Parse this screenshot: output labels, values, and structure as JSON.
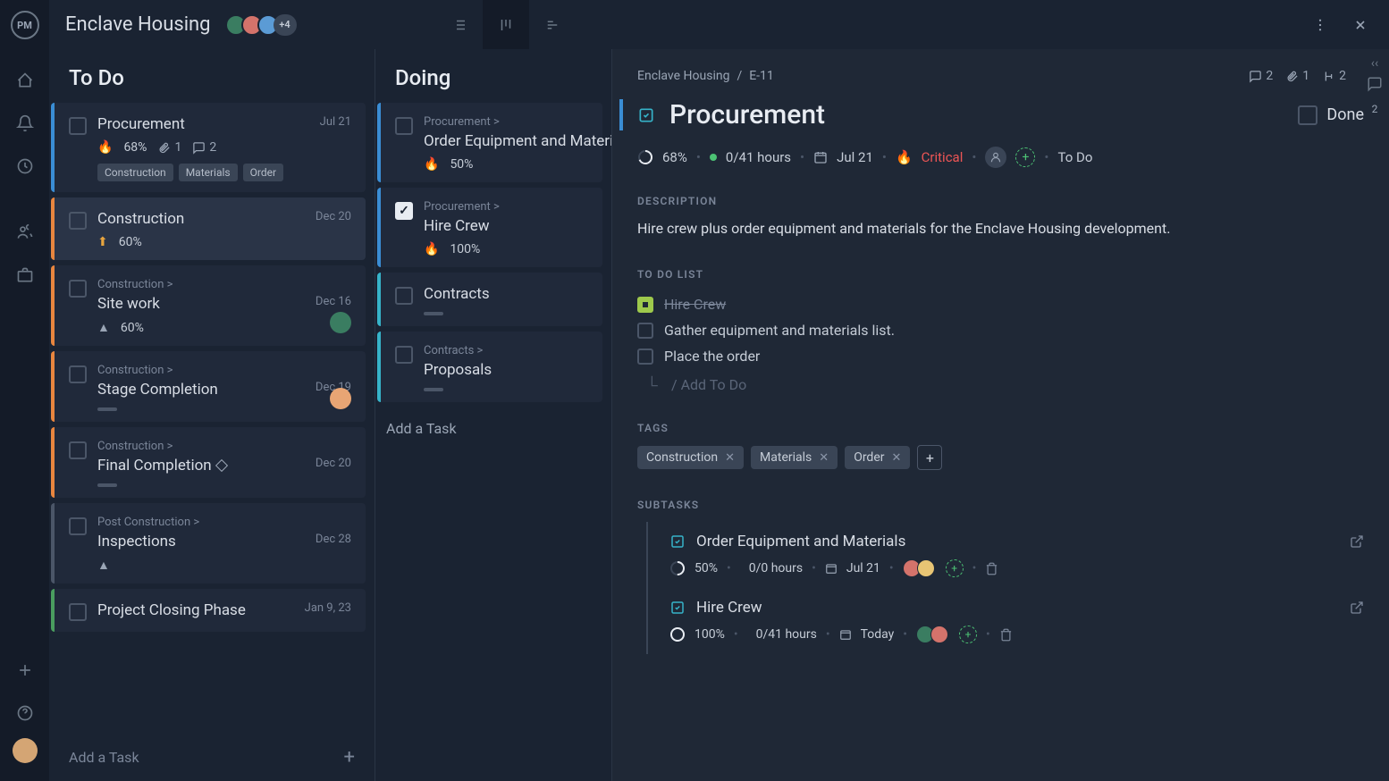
{
  "header": {
    "title": "Enclave Housing",
    "avatar_overflow": "+4"
  },
  "columns": {
    "todo": {
      "title": "To Do",
      "add_label": "Add a Task",
      "cards": [
        {
          "title": "Procurement",
          "date": "Jul 21",
          "pct": "68%",
          "attach": "1",
          "comments": "2",
          "tags": [
            "Construction",
            "Materials",
            "Order"
          ]
        },
        {
          "title": "Construction",
          "date": "Dec 20",
          "pct": "60%"
        },
        {
          "title": "Site work",
          "parent": "Construction >",
          "date": "Dec 16",
          "pct": "60%"
        },
        {
          "title": "Stage Completion",
          "parent": "Construction >",
          "date": "Dec 19"
        },
        {
          "title": "Final Completion",
          "parent": "Construction >",
          "date": "Dec 20"
        },
        {
          "title": "Inspections",
          "parent": "Post Construction >",
          "date": "Dec 28"
        },
        {
          "title": "Project Closing Phase",
          "date": "Jan 9, 23"
        }
      ]
    },
    "doing": {
      "title": "Doing",
      "add_label": "Add a Task",
      "cards": [
        {
          "title": "Order Equipment and Materials",
          "parent": "Procurement >",
          "pct": "50%"
        },
        {
          "title": "Hire Crew",
          "parent": "Procurement >",
          "pct": "100%"
        },
        {
          "title": "Contracts"
        },
        {
          "title": "Proposals",
          "parent": "Contracts >"
        }
      ]
    }
  },
  "detail": {
    "crumb_project": "Enclave Housing",
    "crumb_id": "E-11",
    "stats": {
      "comments": "2",
      "attachments": "1",
      "subtasks": "2"
    },
    "title": "Procurement",
    "done_label": "Done",
    "meta": {
      "pct": "68%",
      "hours": "0/41 hours",
      "date": "Jul 21",
      "priority": "Critical",
      "status": "To Do"
    },
    "desc_label": "DESCRIPTION",
    "description": "Hire crew plus order equipment and materials for the Enclave Housing development.",
    "todo_label": "TO DO LIST",
    "todos": [
      {
        "text": "Hire Crew",
        "done": true
      },
      {
        "text": "Gather equipment and materials list.",
        "done": false
      },
      {
        "text": "Place the order",
        "done": false
      }
    ],
    "add_todo": "/ Add To Do",
    "tags_label": "TAGS",
    "tags": [
      "Construction",
      "Materials",
      "Order"
    ],
    "subtasks_label": "SUBTASKS",
    "subtasks": [
      {
        "title": "Order Equipment and Materials",
        "pct": "50%",
        "hours": "0/0 hours",
        "date": "Jul 21"
      },
      {
        "title": "Hire Crew",
        "pct": "100%",
        "hours": "0/41 hours",
        "date": "Today"
      }
    ],
    "side_count": "2"
  }
}
